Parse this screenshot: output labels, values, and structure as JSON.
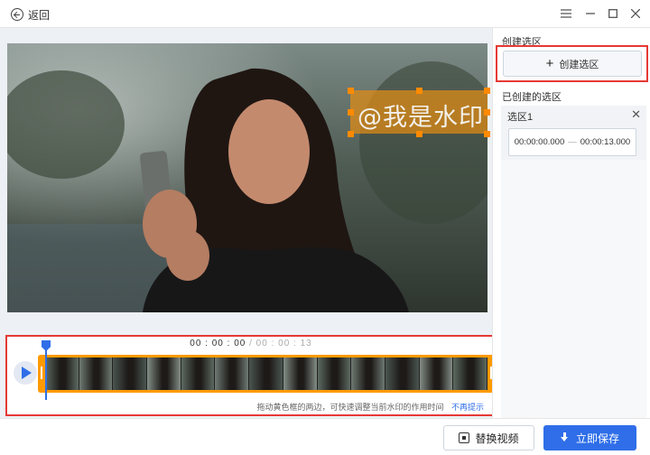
{
  "titlebar": {
    "back_label": "返回",
    "controls": [
      "menu-icon",
      "minimize-icon",
      "maximize-icon",
      "close-icon"
    ]
  },
  "preview": {
    "watermark_text": "@我是水印"
  },
  "timeline": {
    "current_time": "00 : 00 : 00",
    "total_time": "00 : 00 : 13",
    "hint_text": "拖动黄色框的两边，可快速调整当前水印的作用时间",
    "hint_link": "不再提示",
    "frame_count": 13
  },
  "panel": {
    "create_section_title": "创建选区",
    "create_button_label": "创建选区",
    "created_section_title": "已创建的选区",
    "selections": [
      {
        "name": "选区1",
        "start": "00:00:00.000",
        "end": "00:00:13.000"
      }
    ]
  },
  "footer": {
    "replace_label": "替换视频",
    "save_label": "立即保存"
  },
  "colors": {
    "accent": "#2f6ee8",
    "highlight_border": "#e53935",
    "selection_orange": "#ff9a00"
  }
}
